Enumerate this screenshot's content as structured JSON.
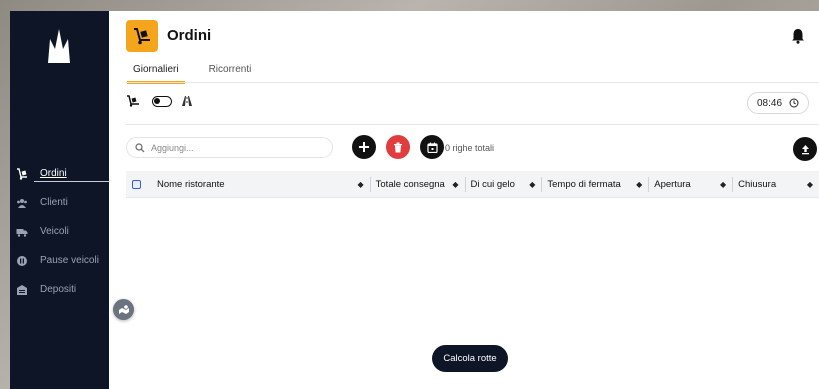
{
  "header": {
    "title": "Ordini",
    "icon": "hand-truck-icon",
    "accent": "#f4a51c"
  },
  "sidebar": {
    "items": [
      {
        "label": "Ordini",
        "icon": "hand-truck-icon",
        "active": true
      },
      {
        "label": "Clienti",
        "icon": "users-icon",
        "active": false
      },
      {
        "label": "Veicoli",
        "icon": "truck-icon",
        "active": false
      },
      {
        "label": "Pause veicoli",
        "icon": "pause-icon",
        "active": false
      },
      {
        "label": "Depositi",
        "icon": "warehouse-icon",
        "active": false
      }
    ]
  },
  "tabs": [
    {
      "label": "Giornalieri",
      "active": true
    },
    {
      "label": "Ricorrenti",
      "active": false
    }
  ],
  "toolbar": {
    "time": "08:46",
    "toggle_on": false
  },
  "search": {
    "placeholder": "Aggiungi..."
  },
  "table": {
    "rows_label": "0 righe totali",
    "columns": [
      "Nome ristorante",
      "Totale consegna",
      "Di cui gelo",
      "Tempo di fermata",
      "Apertura",
      "Chiusura"
    ],
    "rows": []
  },
  "actions": {
    "calculate_label": "Calcola rotte"
  },
  "colors": {
    "sidebar_bg": "#0d1526",
    "delete_red": "#e03e3e",
    "dark_button": "#111111"
  }
}
